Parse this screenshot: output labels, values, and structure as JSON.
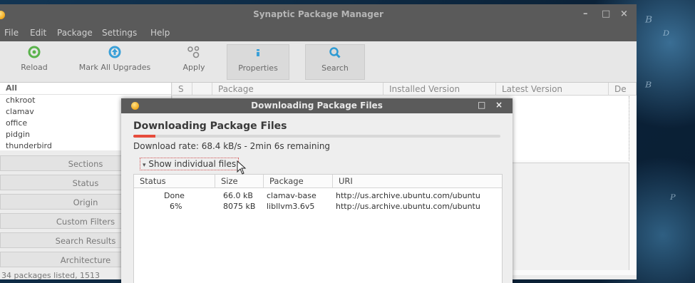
{
  "window": {
    "title": "Synaptic Package Manager",
    "minimize": "–",
    "maximize": "□",
    "close": "×"
  },
  "menu": [
    "File",
    "Edit",
    "Package",
    "Settings",
    "Help"
  ],
  "toolbar": [
    {
      "label": "Reload",
      "icon": "reload-icon"
    },
    {
      "label": "Mark All Upgrades",
      "icon": "upgrade-icon"
    },
    {
      "label": "Apply",
      "icon": "apply-icon"
    },
    {
      "label": "Properties",
      "icon": "properties-icon"
    },
    {
      "label": "Search",
      "icon": "search-icon"
    }
  ],
  "filter_list": {
    "header": "All",
    "items": [
      "chkroot",
      "clamav",
      "office",
      "pidgin",
      "thunderbird"
    ]
  },
  "sidebar_buttons": [
    "Sections",
    "Status",
    "Origin",
    "Custom Filters",
    "Search Results",
    "Architecture"
  ],
  "status_text": "34 packages listed, 1513",
  "package_columns": [
    "S",
    "Package",
    "Installed Version",
    "Latest Version",
    "De"
  ],
  "dialog": {
    "title": "Downloading Package Files",
    "heading": "Downloading Package Files",
    "progress": 0.06,
    "rate_text": "Download rate: 68.4 kB/s - 2min 6s remaining",
    "expander_label": "Show individual files",
    "expander_arrow": "▾",
    "ctl_max": "□",
    "ctl_close": "×",
    "columns": [
      "Status",
      "Size",
      "Package",
      "URI"
    ],
    "rows": [
      {
        "status": "Done",
        "size": "66.0 kB",
        "package": "clamav-base",
        "uri": "http://us.archive.ubuntu.com/ubuntu"
      },
      {
        "status": "6%",
        "size": "8075 kB",
        "package": "libllvm3.6v5",
        "uri": "http://us.archive.ubuntu.com/ubuntu"
      }
    ]
  },
  "colors": {
    "accent_progress": "#e64c3c",
    "titlebar": "#5a5a5a"
  }
}
